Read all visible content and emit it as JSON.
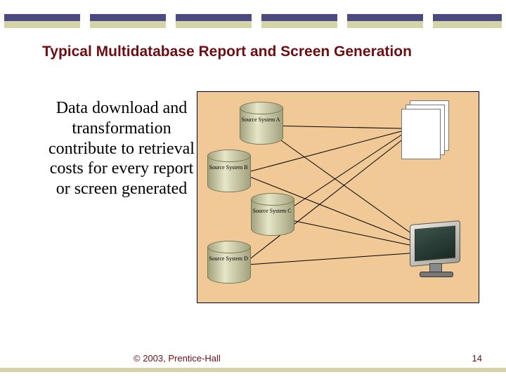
{
  "title": "Typical Multidatabase Report and Screen Generation",
  "body_text": "Data download and transformation contribute to retrieval costs for every report or screen generated",
  "db": {
    "a": "Source System A",
    "b": "Source System B",
    "c": "Source System C",
    "d": "Source System D"
  },
  "footer": {
    "copyright": "© 2003, Prentice-Hall",
    "page": "14"
  },
  "colors": {
    "accent_dark": "#4b4b82",
    "accent_light": "#d4d4a8",
    "heading": "#6d0e12",
    "diagram_bg": "#f0c996"
  }
}
